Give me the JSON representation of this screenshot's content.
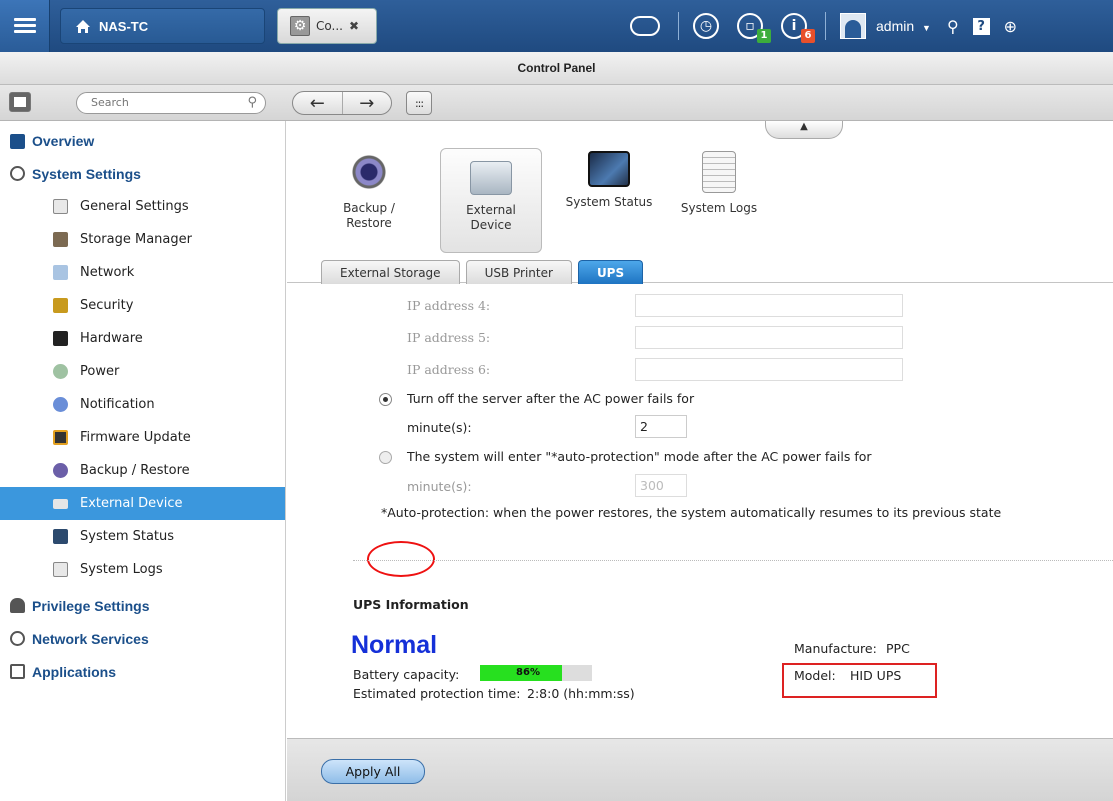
{
  "topbar": {
    "home_label": "NAS-TC",
    "app_tab_label": "Co...",
    "app_tab_close": "✖",
    "info_badge": "6",
    "device_badge": "1",
    "user_name": "admin",
    "user_caret": "▼",
    "help_label": "?"
  },
  "window": {
    "title": "Control Panel"
  },
  "toolbar": {
    "search_placeholder": "Search",
    "back_label": "←",
    "forward_label": "→",
    "grid_label": ":::"
  },
  "sidebar": {
    "overview": "Overview",
    "system_settings": "System Settings",
    "items": [
      "General Settings",
      "Storage Manager",
      "Network",
      "Security",
      "Hardware",
      "Power",
      "Notification",
      "Firmware Update",
      "Backup / Restore",
      "External Device",
      "System Status",
      "System Logs"
    ],
    "privilege_settings": "Privilege Settings",
    "network_services": "Network Services",
    "applications": "Applications"
  },
  "apps": {
    "backup_l1": "Backup /",
    "backup_l2": "Restore",
    "external_l1": "External",
    "external_l2": "Device",
    "system_status": "System Status",
    "system_logs": "System Logs"
  },
  "subtabs": {
    "external_storage": "External Storage",
    "usb_printer": "USB Printer",
    "ups": "UPS"
  },
  "ups_form": {
    "ip4_label": "IP address 4:",
    "ip5_label": "IP address 5:",
    "ip6_label": "IP address 6:",
    "opt1_label": "Turn off the server after the AC power fails for",
    "minutes_label": "minute(s):",
    "opt1_minutes": "2",
    "opt2_label": "The system will enter \"*auto-protection\" mode after the AC power fails for",
    "opt2_minutes": "300",
    "note": "*Auto-protection: when the power restores, the system automatically resumes to its previous state"
  },
  "ups_info": {
    "title": "UPS Information",
    "status": "Normal",
    "battery_label": "Battery capacity:",
    "battery_percent": 86,
    "battery_text": "86%",
    "protection_time_label": "Estimated protection time:",
    "protection_time_value": "2:8:0 (hh:mm:ss)",
    "manufacture_label": "Manufacture:",
    "manufacture_value": "PPC",
    "model_label": "Model:",
    "model_value": "HID UPS"
  },
  "footer": {
    "apply_label": "Apply All"
  },
  "colors": {
    "accent": "#3b97dd",
    "status_normal": "#1530d8",
    "battery_fill": "#27e01f",
    "highlight_red": "#dd2222"
  }
}
